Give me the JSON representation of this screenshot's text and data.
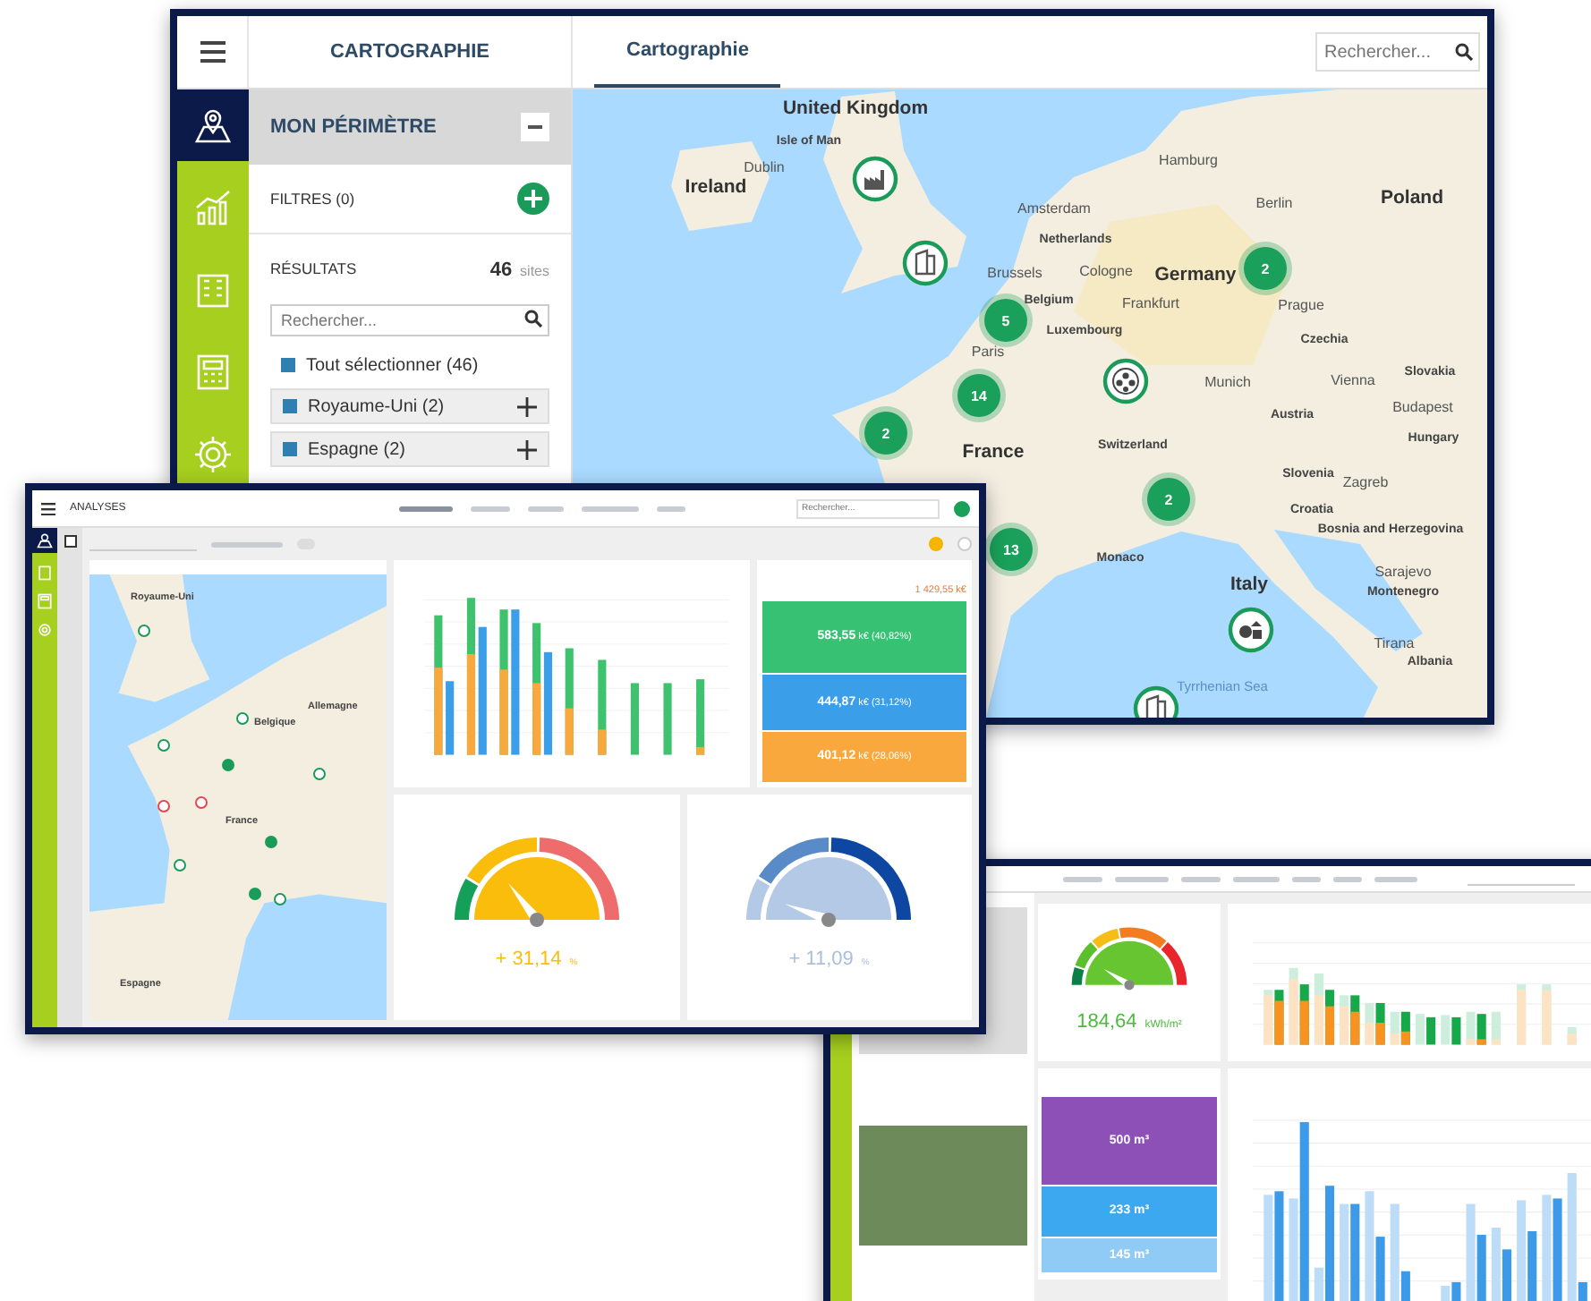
{
  "map_window": {
    "app_title": "CARTOGRAPHIE",
    "tabs": [
      {
        "label": "Cartographie",
        "selected": true
      }
    ],
    "search": {
      "placeholder": "Rechercher..."
    },
    "nav": [
      {
        "kind": "map",
        "selected": true
      },
      {
        "kind": "chart",
        "selected": false
      },
      {
        "kind": "building",
        "selected": false
      },
      {
        "kind": "report",
        "selected": false
      },
      {
        "kind": "settings",
        "selected": false
      }
    ],
    "panel": {
      "title": "MON PÉRIMÈTRE",
      "filters": "FILTRES (0)",
      "results_label": "RÉSULTATS",
      "results_count": "46",
      "results_unit": "sites",
      "search": {
        "placeholder": "Rechercher..."
      },
      "items": [
        {
          "label": "Tout sélectionner (46)",
          "kind": "all",
          "checked": true
        },
        {
          "label": "Royaume-Uni (2)",
          "kind": "group",
          "checked": true
        },
        {
          "label": "Espagne (2)",
          "kind": "group",
          "checked": true
        }
      ]
    },
    "map": {
      "labels": [
        {
          "text": "United Kingdom",
          "kind": "country"
        },
        {
          "text": "Isle of Man",
          "kind": "region"
        },
        {
          "text": "Ireland",
          "kind": "country"
        },
        {
          "text": "Dublin",
          "kind": "city"
        },
        {
          "text": "Hamburg",
          "kind": "city"
        },
        {
          "text": "Berlin",
          "kind": "city"
        },
        {
          "text": "Poland",
          "kind": "country"
        },
        {
          "text": "Amsterdam",
          "kind": "city"
        },
        {
          "text": "Netherlands",
          "kind": "region"
        },
        {
          "text": "Brussels",
          "kind": "city"
        },
        {
          "text": "Cologne",
          "kind": "city"
        },
        {
          "text": "Germany",
          "kind": "country"
        },
        {
          "text": "Belgium",
          "kind": "region"
        },
        {
          "text": "Frankfurt",
          "kind": "city"
        },
        {
          "text": "Luxembourg",
          "kind": "region"
        },
        {
          "text": "Prague",
          "kind": "city"
        },
        {
          "text": "Czechia",
          "kind": "region"
        },
        {
          "text": "Paris",
          "kind": "city"
        },
        {
          "text": "Munich",
          "kind": "city"
        },
        {
          "text": "Vienna",
          "kind": "city"
        },
        {
          "text": "Slovakia",
          "kind": "region"
        },
        {
          "text": "Austria",
          "kind": "region"
        },
        {
          "text": "Budapest",
          "kind": "city"
        },
        {
          "text": "Hungary",
          "kind": "region"
        },
        {
          "text": "France",
          "kind": "country"
        },
        {
          "text": "Switzerland",
          "kind": "region"
        },
        {
          "text": "Slovenia",
          "kind": "region"
        },
        {
          "text": "Zagreb",
          "kind": "city"
        },
        {
          "text": "Croatia",
          "kind": "region"
        },
        {
          "text": "Bosnia and Herzegovina",
          "kind": "region"
        },
        {
          "text": "Monaco",
          "kind": "region"
        },
        {
          "text": "Sarajevo",
          "kind": "city"
        },
        {
          "text": "Montenegro",
          "kind": "region"
        },
        {
          "text": "Italy",
          "kind": "country"
        },
        {
          "text": "Tirana",
          "kind": "city"
        },
        {
          "text": "Albania",
          "kind": "region"
        },
        {
          "text": "Tyrrhenian Sea",
          "kind": "sea"
        }
      ],
      "markers": [
        {
          "kind": "factory"
        },
        {
          "kind": "building"
        },
        {
          "kind": "cluster",
          "count": "2"
        },
        {
          "kind": "cluster",
          "count": "5"
        },
        {
          "kind": "cluster",
          "count": "14"
        },
        {
          "kind": "stadium"
        },
        {
          "kind": "cluster",
          "count": "2"
        },
        {
          "kind": "cluster",
          "count": "2"
        },
        {
          "kind": "cluster",
          "count": "13"
        },
        {
          "kind": "mixed"
        },
        {
          "kind": "building"
        }
      ]
    }
  },
  "dashboard_window": {
    "app_title": "ANALYSES",
    "search": {
      "placeholder": "Rechercher..."
    },
    "toggle": {
      "on": false
    },
    "map": {
      "labels": [
        {
          "text": "Royaume-Uni"
        },
        {
          "text": "Belgique"
        },
        {
          "text": "Allemagne"
        },
        {
          "text": "France"
        },
        {
          "text": "Espagne"
        }
      ],
      "markers": [
        {
          "kind": "icon",
          "color": "#1a9b5a"
        },
        {
          "kind": "icon",
          "color": "#1a9b5a"
        },
        {
          "kind": "icon",
          "color": "#1a9b5a"
        },
        {
          "kind": "cluster",
          "color": "#1a9b5a"
        },
        {
          "kind": "icon",
          "color": "#1a9b5a"
        },
        {
          "kind": "icon",
          "color": "#e8464b"
        },
        {
          "kind": "icon",
          "color": "#e8464b"
        },
        {
          "kind": "cluster",
          "color": "#1a9b5a"
        },
        {
          "kind": "icon",
          "color": "#1a9b5a"
        },
        {
          "kind": "cluster",
          "color": "#1a9b5a"
        },
        {
          "kind": "icon",
          "color": "#1a9b5a"
        }
      ]
    },
    "treemap": {
      "total": "1 429,55 k€",
      "segments": [
        {
          "value": "583,55",
          "detail": "k€ (40,82%)",
          "color": "#37c172"
        },
        {
          "value": "444,87",
          "detail": "k€ (31,12%)",
          "color": "#3a9ee9"
        },
        {
          "value": "401,12",
          "detail": "k€ (28,06%)",
          "color": "#f8a83d"
        }
      ]
    },
    "gauges": [
      {
        "value": "+ 31,14",
        "unit": "%"
      },
      {
        "value": "+ 11,09",
        "unit": "%"
      }
    ]
  },
  "building_window": {
    "gauge": {
      "value": "184,64",
      "unit": "kWh/m²"
    },
    "treemap": {
      "segments": [
        {
          "value": "500 m³",
          "color": "#8d50b6"
        },
        {
          "value": "233 m³",
          "color": "#3ba8ef"
        },
        {
          "value": "145 m³",
          "color": "#8fcbf5"
        }
      ]
    }
  }
}
